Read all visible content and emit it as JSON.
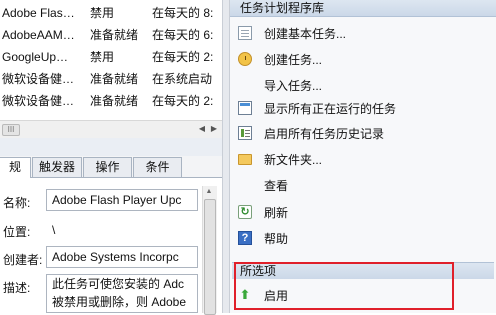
{
  "task_list": {
    "rows": [
      {
        "name": "Adobe Flas…",
        "status": "禁用",
        "trigger": "在每天的 8:"
      },
      {
        "name": "AdobeAAM…",
        "status": "准备就绪",
        "trigger": "在每天的 6:"
      },
      {
        "name": "GoogleUp…",
        "status": "禁用",
        "trigger": "在每天的 2:"
      },
      {
        "name": "微软设备健…",
        "status": "准备就绪",
        "trigger": "在系统启动"
      },
      {
        "name": "微软设备健…",
        "status": "准备就绪",
        "trigger": "在每天的 2:"
      }
    ],
    "scroll_thumb": "III"
  },
  "tabs": [
    "规",
    "触发器",
    "操作",
    "条件"
  ],
  "details": {
    "name_label": "名称:",
    "name_value": "Adobe Flash Player Upc",
    "location_label": "位置:",
    "location_value": "\\",
    "author_label": "创建者:",
    "author_value": "Adobe Systems Incorpc",
    "desc_label": "描述:",
    "desc_line1": "此任务可使您安装的 Adc",
    "desc_line2": "被禁用或删除，则 Adobe"
  },
  "actions": {
    "header": "任务计划程序库",
    "items": [
      {
        "icon": "create-basic-task-icon",
        "label": "创建基本任务..."
      },
      {
        "icon": "create-task-icon",
        "label": "创建任务..."
      },
      {
        "icon": "import-task-icon",
        "label": "导入任务..."
      },
      {
        "icon": "running-tasks-icon",
        "label": "显示所有正在运行的任务"
      },
      {
        "icon": "task-history-icon",
        "label": "启用所有任务历史记录"
      },
      {
        "icon": "folder-icon",
        "label": "新文件夹..."
      },
      {
        "icon": "view-icon",
        "label": "查看"
      },
      {
        "icon": "refresh-icon",
        "label": "刷新"
      },
      {
        "icon": "help-icon",
        "label": "帮助"
      }
    ],
    "selected_header": "所选项",
    "enable_label": "启用"
  },
  "colors": {
    "highlight": "#e0202a",
    "pane_header": "#cbd8e8",
    "enable_arrow": "#39a83a"
  }
}
